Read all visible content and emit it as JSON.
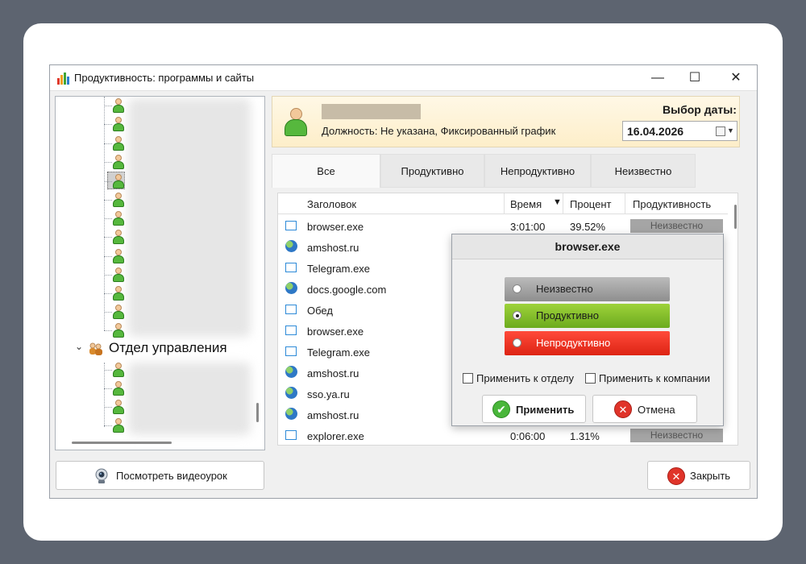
{
  "window": {
    "title": "Продуктивность: программы и сайты",
    "minimize_glyph": "—",
    "maximize_glyph": "☐",
    "close_glyph": "✕"
  },
  "tree": {
    "department_label": "Отдел управления",
    "expand_glyph": "⌄",
    "user_icon": "user-icon",
    "department_icon": "department-icon"
  },
  "video_button": {
    "label": "Посмотреть видеоурок",
    "icon": "webcam-icon"
  },
  "employee": {
    "position_text": "Должность: Не указана, Фиксированный график",
    "avatar_icon": "avatar-icon"
  },
  "date": {
    "label": "Выбор даты:",
    "value": "16.04.2026"
  },
  "tabs": [
    {
      "label": "Все",
      "active": true
    },
    {
      "label": "Продуктивно",
      "active": false
    },
    {
      "label": "Непродуктивно",
      "active": false
    },
    {
      "label": "Неизвестно",
      "active": false
    }
  ],
  "table": {
    "columns": [
      "Заголовок",
      "Время",
      "Процент",
      "Продуктивность"
    ],
    "sort_glyph": "▼",
    "rows": [
      {
        "icon": "window-icon",
        "title": "browser.exe",
        "time": "3:01:00",
        "percent": "39.52%",
        "productivity": "Неизвестно"
      },
      {
        "icon": "globe-icon",
        "title": "amshost.ru",
        "time": "",
        "percent": "",
        "productivity": ""
      },
      {
        "icon": "window-icon",
        "title": "Telegram.exe",
        "time": "",
        "percent": "",
        "productivity": ""
      },
      {
        "icon": "globe-icon",
        "title": "docs.google.com",
        "time": "",
        "percent": "",
        "productivity": ""
      },
      {
        "icon": "window-icon",
        "title": "Обед",
        "time": "",
        "percent": "",
        "productivity": ""
      },
      {
        "icon": "window-icon",
        "title": "browser.exe",
        "time": "",
        "percent": "",
        "productivity": ""
      },
      {
        "icon": "window-icon",
        "title": "Telegram.exe",
        "time": "",
        "percent": "",
        "productivity": ""
      },
      {
        "icon": "globe-icon",
        "title": "amshost.ru",
        "time": "",
        "percent": "",
        "productivity": ""
      },
      {
        "icon": "globe-icon",
        "title": "sso.ya.ru",
        "time": "",
        "percent": "",
        "productivity": ""
      },
      {
        "icon": "globe-icon",
        "title": "amshost.ru",
        "time": "",
        "percent": "",
        "productivity": ""
      },
      {
        "icon": "window-icon",
        "title": "explorer.exe",
        "time": "0:06:00",
        "percent": "1.31%",
        "productivity": "Неизвестно"
      }
    ]
  },
  "popup": {
    "title": "browser.exe",
    "options": [
      {
        "label": "Неизвестно",
        "checked": false
      },
      {
        "label": "Продуктивно",
        "checked": true
      },
      {
        "label": "Непродуктивно",
        "checked": false
      }
    ],
    "apply_to_department": "Применить к отделу",
    "apply_to_company": "Применить к компании",
    "apply_button": "Применить",
    "cancel_button": "Отмена",
    "apply_glyph": "✔",
    "cancel_glyph": "✕"
  },
  "close_button": {
    "label": "Закрыть",
    "glyph": "✕"
  },
  "colors": {
    "productive": "#7dbb26",
    "unproductive": "#e8301f",
    "unknown": "#a5a5a5",
    "header_bg": "#fdeec9"
  }
}
